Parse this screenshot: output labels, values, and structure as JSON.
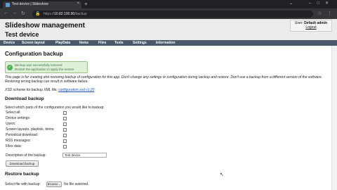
{
  "browser": {
    "tab_title": "Test device | Slideshow",
    "new_tab": "+",
    "tab_close": "×",
    "url_host": "10.82.100.90",
    "url_path": "/backup",
    "url_scheme": "https://"
  },
  "header": {
    "app_title": "Slideshow management",
    "device_title": "Test device",
    "user_label": "User:",
    "user_name": "Default admin",
    "logout": "Logout"
  },
  "menu": {
    "items": [
      "Device",
      "Screen layout",
      "PlayData",
      "Items",
      "Files",
      "Texts",
      "Settings",
      "Information"
    ]
  },
  "page": {
    "heading": "Configuration backup",
    "success_line1": "Backup was successfully restored",
    "success_line2": "Restart the application to apply the restore",
    "intro": "This page is for creating and restoring backup of configuration for this app. Don't change any settings or configuration during backup and restore. Don't use a backup from a different version of the software. Restoring wrong backup can result in software failure.",
    "xsd_text": "XSD scheme for backup XML file:",
    "xsd_link": "configuration.xsd v1.25",
    "download_heading": "Download backup",
    "select_intro": "Select which parts of the configuration you would like to backup:",
    "options": [
      "Select all:",
      "Device settings:",
      "Users:",
      "Screen layouts, playlists, items:",
      "Periodical download:",
      "RSS messages:",
      "Files data:"
    ],
    "description_label": "Description of the backup:",
    "description_value": "Test device",
    "download_button": "Download backup",
    "restore_heading": "Restore backup",
    "file_label": "Select file with backup:",
    "browse_button": "Browse...",
    "no_file": "No file selected."
  }
}
